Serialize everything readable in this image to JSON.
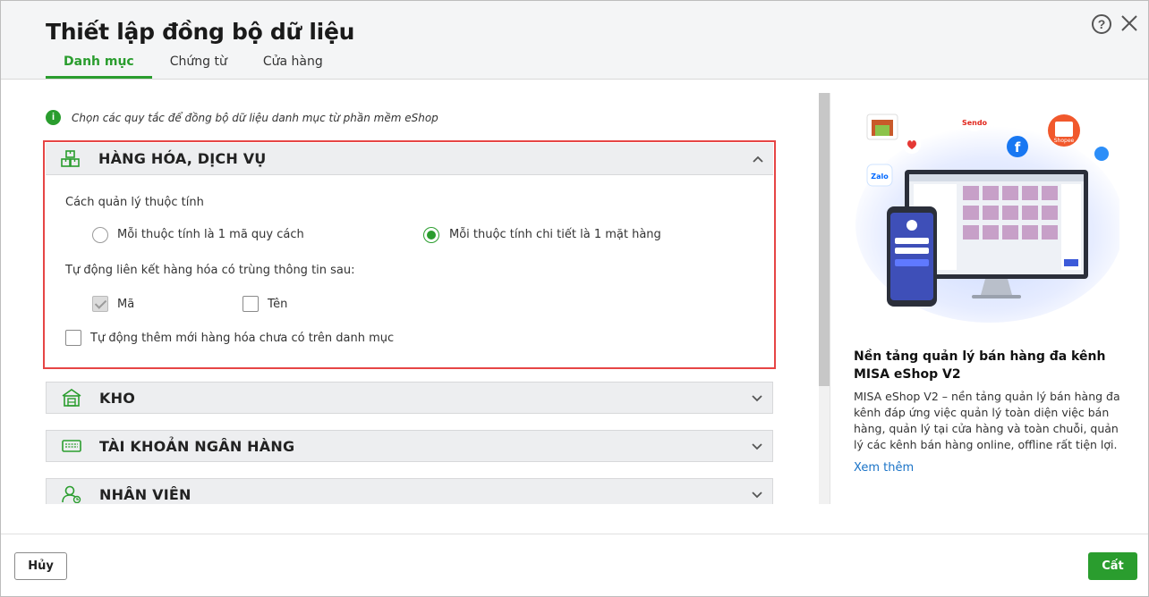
{
  "dialog": {
    "title": "Thiết lập đồng bộ dữ liệu",
    "tabs": [
      {
        "label": "Danh mục",
        "active": true
      },
      {
        "label": "Chứng từ",
        "active": false
      },
      {
        "label": "Cửa hàng",
        "active": false
      }
    ],
    "help_glyph": "?"
  },
  "info": {
    "glyph": "i",
    "text": "Chọn các quy tắc để đồng bộ dữ liệu danh mục từ phần mềm eShop"
  },
  "sections": {
    "goods": {
      "title": "HÀNG HÓA, DỊCH VỤ",
      "icon": "goods-boxes-icon",
      "expanded": true,
      "attr_label": "Cách quản lý thuộc tính",
      "radio_option_1": "Mỗi thuộc tính là 1 mã quy cách",
      "radio_option_2": "Mỗi thuộc tính chi tiết là 1 mặt hàng",
      "selected_radio": 2,
      "link_label": "Tự động liên kết hàng hóa có trùng thông tin sau:",
      "check_code": {
        "label": "Mã",
        "checked": true,
        "disabled": true
      },
      "check_name": {
        "label": "Tên",
        "checked": false
      },
      "auto_add": {
        "label": "Tự động thêm mới hàng hóa chưa có trên danh mục",
        "checked": false
      }
    },
    "warehouse": {
      "title": "KHO",
      "icon": "warehouse-icon"
    },
    "bank": {
      "title": "TÀI KHOẢN NGÂN HÀNG",
      "icon": "bank-card-icon"
    },
    "staff": {
      "title": "NHÂN VIÊN",
      "icon": "staff-icon"
    }
  },
  "promo": {
    "title": "Nền tảng quản lý bán hàng đa kênh MISA eShop V2",
    "description": "MISA eShop V2 – nền tảng quản lý bán hàng đa kênh đáp ứng việc quản lý toàn diện việc bán hàng, quản lý tại cửa hàng và toàn chuỗi, quản lý các kênh bán hàng online, offline rất tiện lợi.",
    "link": "Xem thêm",
    "badges": {
      "sendo": "Sendo",
      "shopee": "Shopee",
      "zalo": "Zalo"
    }
  },
  "footer": {
    "cancel_label": "Hủy",
    "save_label": "Cất"
  },
  "colors": {
    "accent": "#2a9d2e",
    "highlight_border": "#e64545",
    "link": "#1a73c7"
  }
}
